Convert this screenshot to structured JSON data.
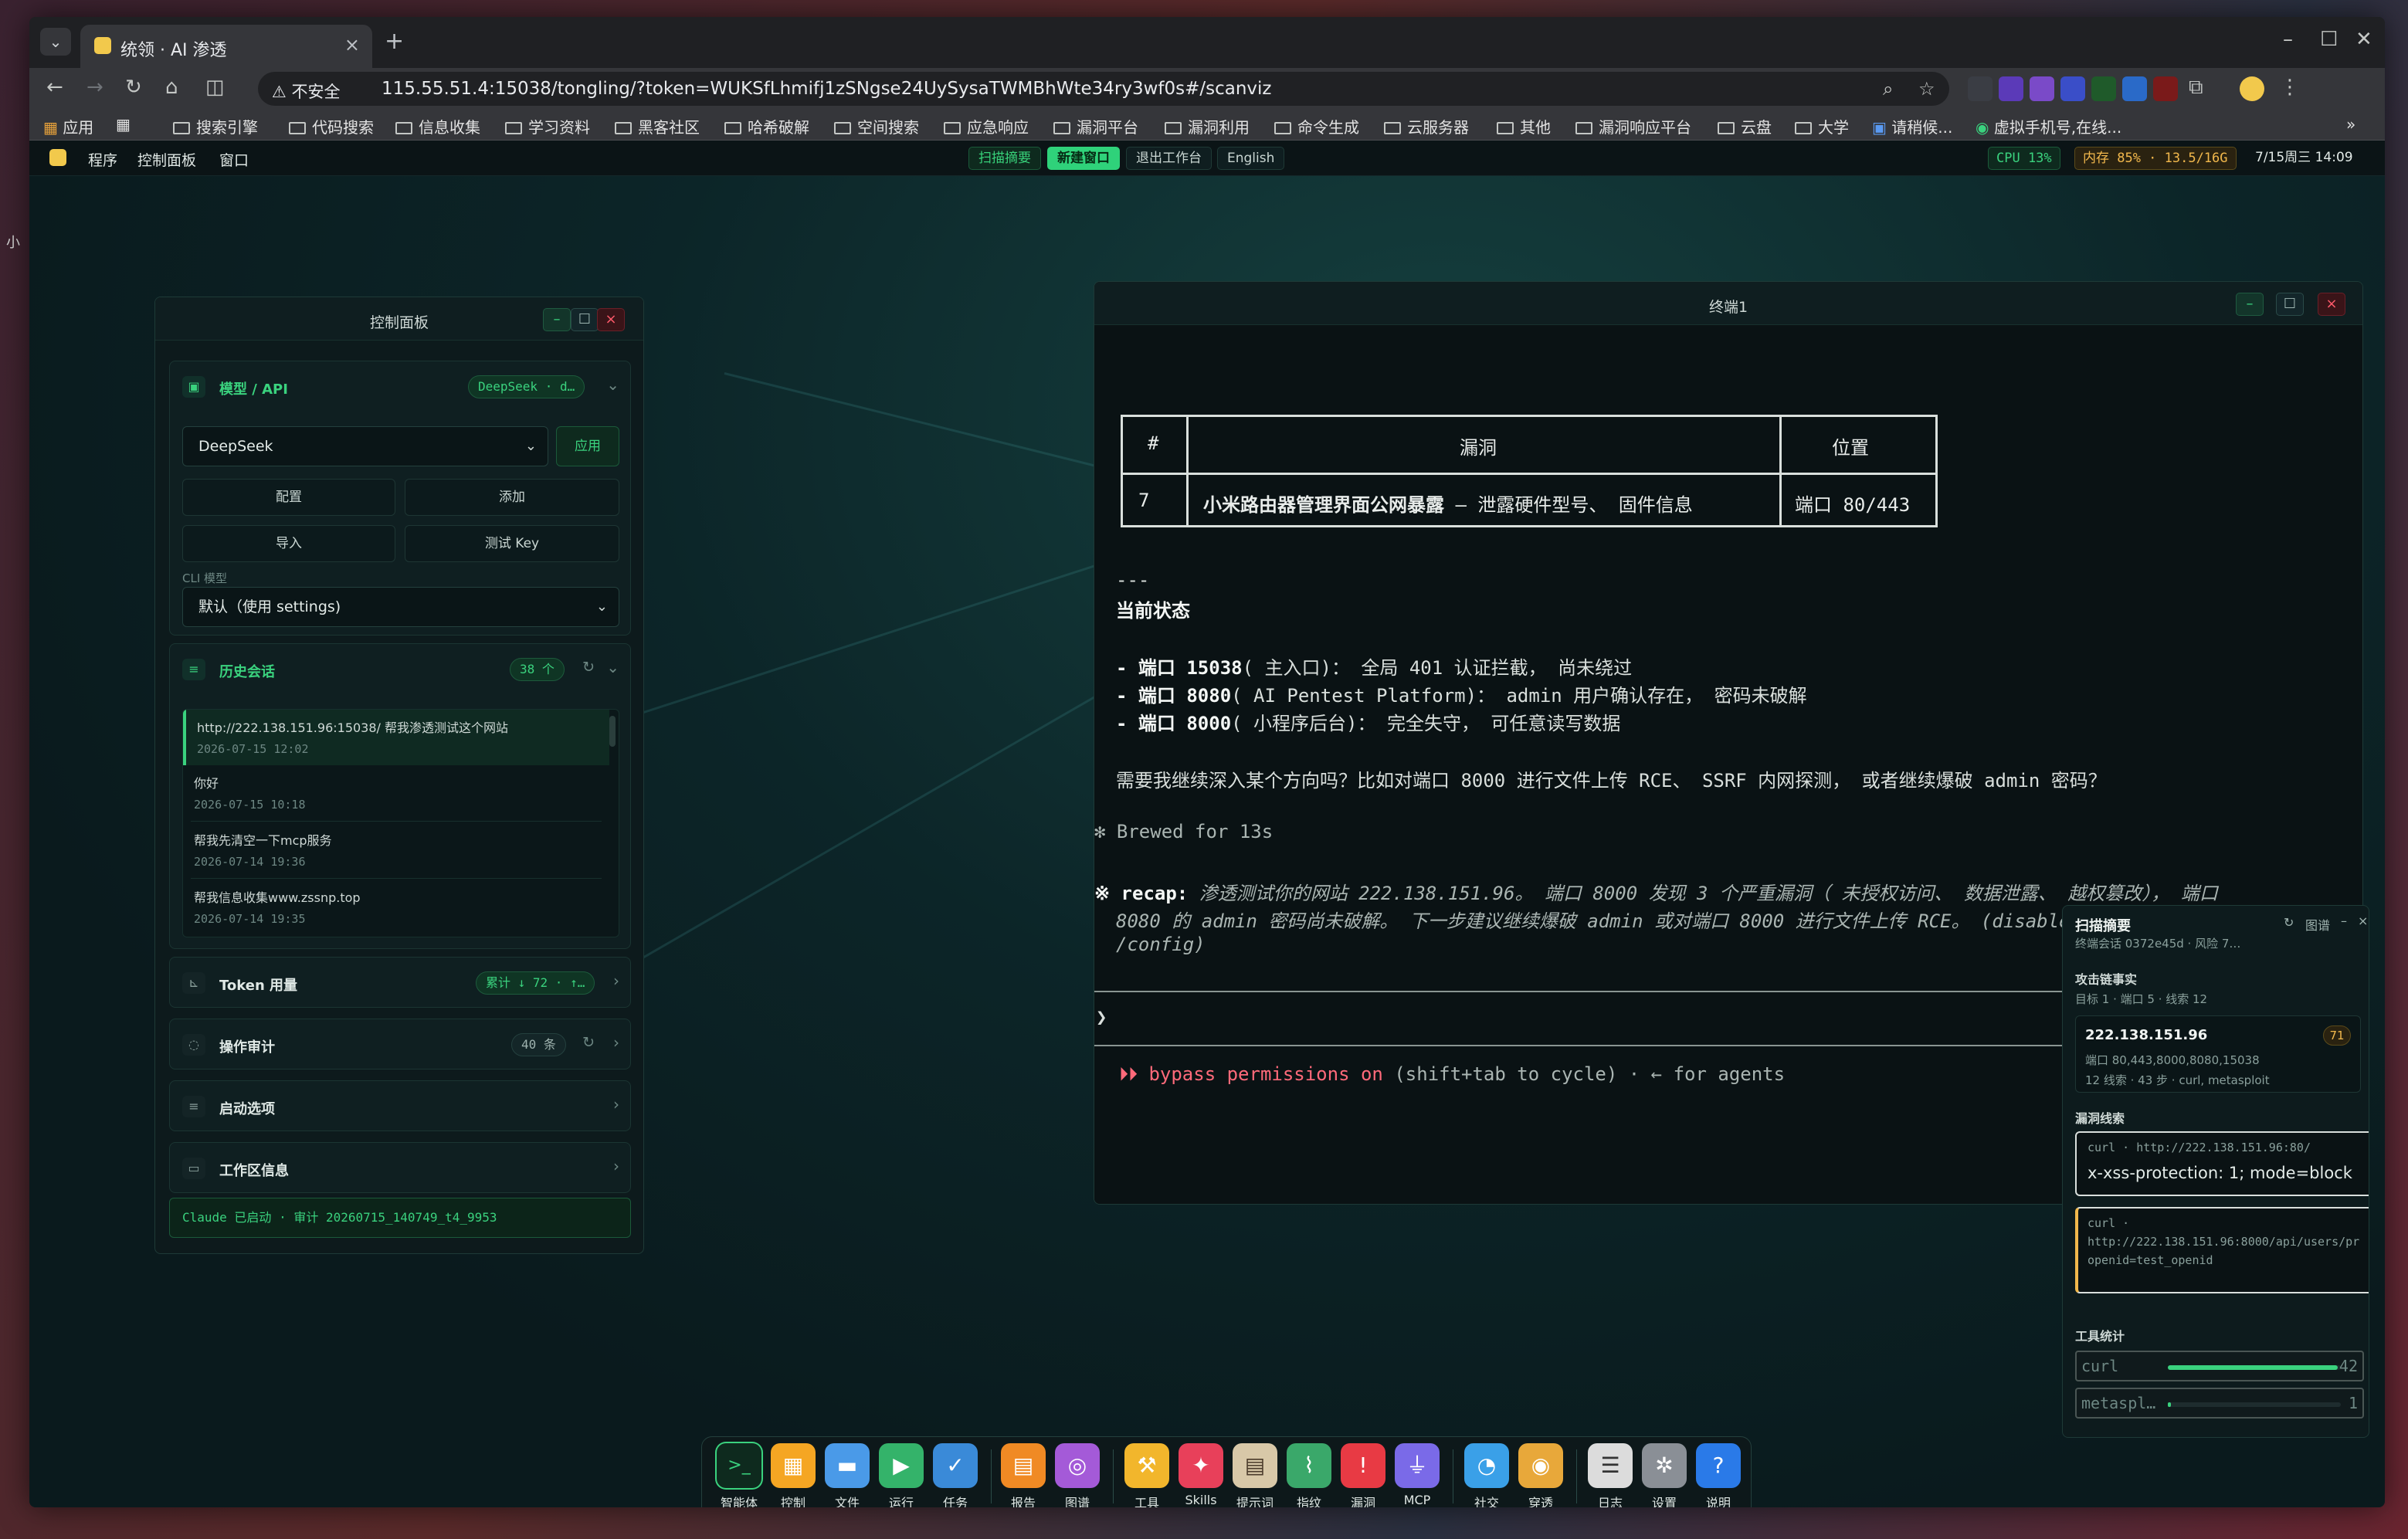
{
  "browser": {
    "tab_title": "统领 · AI 渗透",
    "insecure_label": "不安全",
    "url": "115.55.51.4:15038/tongling/?token=WUKSfLhmifj1zSNgse24UySysaTWMBhWte34ry3wf0s#/scanviz",
    "bookmarks": [
      "应用",
      "搜索引擎",
      "代码搜索",
      "信息收集",
      "学习资料",
      "黑客社区",
      "哈希破解",
      "空间搜索",
      "应急响应",
      "漏洞平台",
      "漏洞利用",
      "命令生成",
      "云服务器",
      "其他",
      "漏洞响应平台",
      "云盘",
      "大学",
      "请稍候...",
      "虚拟手机号,在线..."
    ]
  },
  "topbar": {
    "menus": [
      "程序",
      "控制面板",
      "窗口"
    ],
    "scan_summary": "扫描摘要",
    "new_window": "新建窗口",
    "exit_workbench": "退出工作台",
    "language": "English",
    "cpu": "CPU 13%",
    "mem": "内存 85% · 13.5/16G",
    "datetime": "7/15周三 14:09"
  },
  "control_panel": {
    "title": "控制面板",
    "model_section": {
      "label": "模型 / API",
      "badge": "DeepSeek · d…",
      "selected_model": "DeepSeek",
      "apply": "应用",
      "btn_config": "配置",
      "btn_add": "添加",
      "btn_import": "导入",
      "btn_test_key": "测试 Key",
      "cli_label": "CLI 模型",
      "cli_selected": "默认（使用 settings)"
    },
    "history": {
      "label": "历史会话",
      "badge": "38 个",
      "items": [
        {
          "q": "http://222.138.151.96:15038/ 帮我渗透测试这个网站",
          "d": "2026-07-15 12:02"
        },
        {
          "q": "你好",
          "d": "2026-07-15 10:18"
        },
        {
          "q": "帮我先清空一下mcp服务",
          "d": "2026-07-14 19:36"
        },
        {
          "q": "帮我信息收集www.zssnp.top",
          "d": "2026-07-14 19:35"
        }
      ]
    },
    "token": {
      "label": "Token 用量",
      "badge": "累计 ↓ 72 · ↑…"
    },
    "audit": {
      "label": "操作审计",
      "badge": "40 条"
    },
    "startup": {
      "label": "启动选项"
    },
    "workspace": {
      "label": "工作区信息"
    },
    "status": "Claude 已启动 · 审计 20260715_140749_t4_9953"
  },
  "terminal": {
    "title": "终端1",
    "table": {
      "headers": [
        "#",
        "漏洞",
        "位置"
      ],
      "row": {
        "num": "7",
        "vuln_bold": "小米路由器管理界面公网暴露",
        "vuln_rest": " — 泄露硬件型号、 固件信息",
        "loc": "端口 80/443"
      }
    },
    "divider": "---",
    "status_heading": "当前状态",
    "bullets": [
      {
        "pre": "- 端口 ",
        "port": "15038",
        "rest": "( 主入口)： 全局 401 认证拦截， 尚未绕过"
      },
      {
        "pre": "- 端口 ",
        "port": "8080",
        "rest": "( AI Pentest Platform)： admin 用户确认存在， 密码未破解"
      },
      {
        "pre": "- 端口 ",
        "port": "8000",
        "rest": "( 小程序后台)： 完全失守， 可任意读写数据"
      }
    ],
    "question": "需要我继续深入某个方向吗？比如对端口 8000 进行文件上传 RCE、 SSRF 内网探测， 或者继续爆破 admin 密码？",
    "brewed": "✻ Brewed for 13s",
    "recap_label": "※ recap:",
    "recap_1": " 渗透测试你的网站 222.138.151.96。 端口 8000 发现 3 个严重漏洞（ 未授权访问、 数据泄露、 越权篡改）， 端口",
    "recap_2": "8080 的 admin 密码尚未破解。 下一步建议继续爆破 admin 或对端口 8000 进行文件上传 RCE。 (disable recaps in",
    "recap_3": "/config)",
    "prompt": "❯",
    "bypass": "⏵⏵ bypass permissions on",
    "bypass_rest": " (shift+tab to cycle) · ← for agents"
  },
  "scan_panel": {
    "title": "扫描摘要",
    "graph": "图谱",
    "subtitle": "终端会话 0372e45d · 风险 7…",
    "chain_title": "攻击链事实",
    "chain_stats": "目标 1 · 端口 5 · 线索 12",
    "target_ip": "222.138.151.96",
    "target_score": "71",
    "target_ports": "端口 80,443,8000,8080,15038",
    "target_meta": "12 线索 · 43 步 · curl, metasploit",
    "clues_title": "漏洞线索",
    "clue1_cmd": "curl · http://222.138.151.96:80/",
    "clue1_text": "x-xss-protection: 1; mode=block",
    "clue2_cmd": "curl ·",
    "clue2_url": "http://222.138.151.96:8000/api/users/pr",
    "clue2_param": "openid=test_openid",
    "tools_title": "工具统计",
    "tools": [
      {
        "name": "curl",
        "count": "42",
        "fraction": 0.98
      },
      {
        "name": "metaspl…",
        "count": "1",
        "fraction": 0.02
      }
    ]
  },
  "dock": {
    "items": [
      "智能体",
      "控制",
      "文件",
      "运行",
      "任务",
      "报告",
      "图谱",
      "工具",
      "Skills",
      "提示词",
      "指纹",
      "漏洞",
      "MCP",
      "社交",
      "穿透",
      "日志",
      "设置",
      "说明"
    ]
  },
  "side_label": "小"
}
